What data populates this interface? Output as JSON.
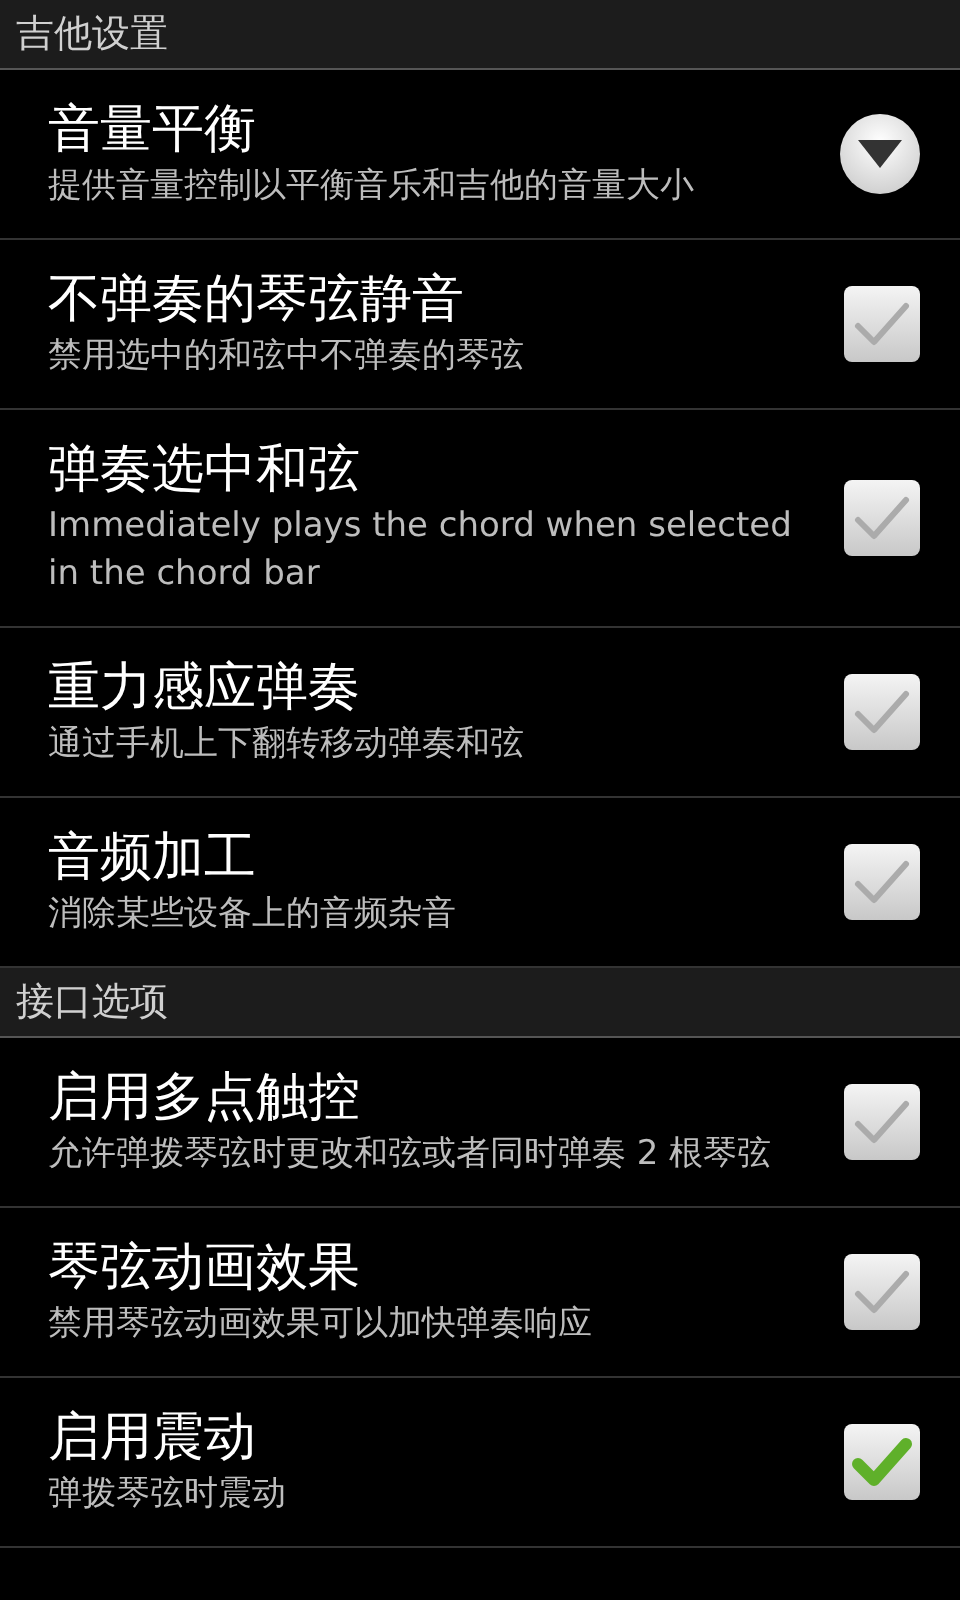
{
  "sections": [
    {
      "title": "吉他设置",
      "items": [
        {
          "kind": "dropdown",
          "title": "音量平衡",
          "subtitle": "提供音量控制以平衡音乐和吉他的音量大小"
        },
        {
          "kind": "checkbox",
          "title": "不弹奏的琴弦静音",
          "subtitle": "禁用选中的和弦中不弹奏的琴弦",
          "checked": false
        },
        {
          "kind": "checkbox",
          "title": "弹奏选中和弦",
          "subtitle": "Immediately plays the chord when selected in the chord bar",
          "checked": false
        },
        {
          "kind": "checkbox",
          "title": "重力感应弹奏",
          "subtitle": "通过手机上下翻转移动弹奏和弦",
          "checked": false
        },
        {
          "kind": "checkbox",
          "title": "音频加工",
          "subtitle": "消除某些设备上的音频杂音",
          "checked": false
        }
      ]
    },
    {
      "title": "接口选项",
      "items": [
        {
          "kind": "checkbox",
          "title": "启用多点触控",
          "subtitle": "允许弹拨琴弦时更改和弦或者同时弹奏 2 根琴弦",
          "checked": false
        },
        {
          "kind": "checkbox",
          "title": "琴弦动画效果",
          "subtitle": "禁用琴弦动画效果可以加快弹奏响应",
          "checked": false
        },
        {
          "kind": "checkbox",
          "title": "启用震动",
          "subtitle": "弹拨琴弦时震动",
          "checked": true
        }
      ]
    }
  ]
}
